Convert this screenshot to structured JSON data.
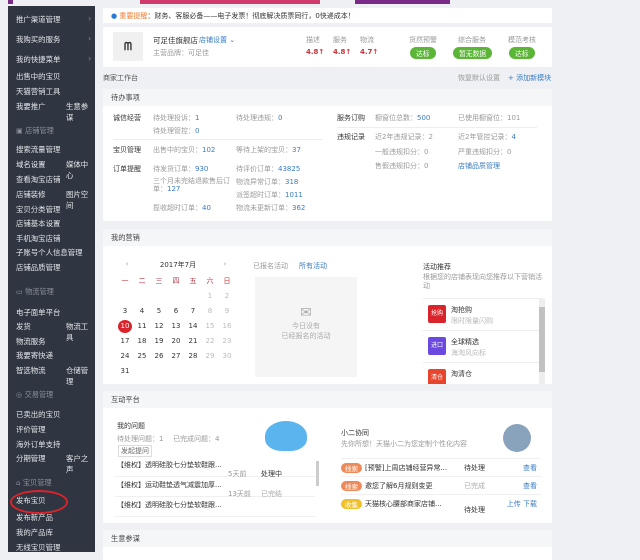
{
  "sidebar": {
    "top_items": [
      {
        "label": "推广渠道管理"
      },
      {
        "label": "我购买的服务"
      },
      {
        "label": "我的快捷菜单"
      }
    ],
    "quick": [
      "出售中的宝贝",
      "天猫营销工具",
      "我要推广",
      "生意参谋"
    ],
    "shop_header": "店铺管理",
    "shop": [
      "搜索流量管理",
      "域名设置",
      "媒体中心",
      "查看淘宝店铺",
      "店铺装修",
      "图片空间",
      "宝贝分类管理",
      "店铺基本设置",
      "手机淘宝店铺",
      "子账号个人信息管理",
      "店铺品质管理"
    ],
    "logistics_header": "物流管理",
    "logistics": [
      "电子面单平台",
      "发货",
      "物流工具",
      "物流服务",
      "我要寄快递",
      "智选物流",
      "仓储管理"
    ],
    "trade_header": "交易管理",
    "trade": [
      "已卖出的宝贝",
      "评价管理",
      "海外订单支持",
      "分期管理",
      "客户之声"
    ],
    "item_header": "宝贝管理",
    "items": [
      "发布宝贝",
      "发布新产品",
      "我的产品库",
      "无线宝贝管理"
    ]
  },
  "notice": {
    "tag": "重要提醒",
    "text": "：财务、客服必备——电子发票！彻底解决质票同行，0快递成本！"
  },
  "shop": {
    "name": "可足佳旗舰店",
    "settings": "店铺设置",
    "brand": "主营品牌：可足佳",
    "scores": [
      {
        "label": "描述",
        "value": "4.8↑"
      },
      {
        "label": "服务",
        "value": "4.8↑"
      },
      {
        "label": "物流",
        "value": "4.7↑"
      }
    ],
    "checks": [
      {
        "label": "货然预警",
        "value": "达标"
      },
      {
        "label": "综合服务",
        "value": "暂无数据"
      },
      {
        "label": "模范考核",
        "value": "达标"
      }
    ]
  },
  "workbench": {
    "title": "商家工作台",
    "restore": "恢复默认设置",
    "add": "+ 添加新模块"
  },
  "todo": {
    "title": "待办事项",
    "c1": "诚信经营",
    "c1a": "待处理投诉：",
    "c1a_v": "1",
    "c1b": "待处理违规：",
    "c1b_v": "0",
    "c1c": "待处理管控：",
    "c1c_v": "0",
    "c2": "宝贝管理",
    "c2a": "出售中的宝贝：",
    "c2a_v": "102",
    "c2b": "等待上架的宝贝：",
    "c2b_v": "37",
    "c3": "订单提醒",
    "c3a": "待发货订单：",
    "c3a_v": "930",
    "c3b": "待评价订单：",
    "c3b_v": "43825",
    "c3c": "三个月未完结退款售后订单：",
    "c3c_v": "127",
    "c3d": "物流异常订单：",
    "c3d_v": "318",
    "c3e": "派签超时订单：",
    "c3e_v": "1011",
    "c3f": "揽收超时订单：",
    "c3f_v": "40",
    "c3g": "物流未更新订单：",
    "c3g_v": "362",
    "r1": "服务订购",
    "r1a": "橱窗位总数：",
    "r1a_v": "500",
    "r1b": "已使用橱窗位：",
    "r1b_v": "101",
    "r2": "违规记录",
    "r2a": "近2年违规记录：",
    "r2a_v": "2",
    "r2b": "近2年管控记录：",
    "r2b_v": "4",
    "r2c": "一般违规扣分：",
    "r2c_v": "0",
    "r2d": "严重违规扣分：",
    "r2d_v": "0",
    "r2e": "售假违规扣分：",
    "r2e_v": "0",
    "r2f": "店铺品质管理"
  },
  "marketing": {
    "title": "我的营销",
    "month": "2017年7月",
    "prev": "‹",
    "next": "›",
    "weekdays": [
      "一",
      "二",
      "三",
      "四",
      "五",
      "六",
      "日"
    ],
    "days": [
      "1",
      "2",
      "3",
      "4",
      "5",
      "6",
      "7",
      "8",
      "9",
      "10",
      "11",
      "12",
      "13",
      "14",
      "15",
      "16",
      "17",
      "18",
      "19",
      "20",
      "21",
      "22",
      "23",
      "24",
      "25",
      "26",
      "27",
      "28",
      "29",
      "30",
      "31"
    ],
    "today": "10",
    "tab_signed": "已报名活动",
    "tab_all": "所有活动",
    "empty1": "今日没有",
    "empty2": "已经报名的活动",
    "rec_title": "活动推荐",
    "rec_desc": "根据您的店铺表现向您推荐以下营销活动",
    "recs": [
      {
        "icon": "抢购",
        "name": "淘抢购",
        "sub": "限时限量闪购",
        "color": "#d9242b"
      },
      {
        "icon": "进口",
        "name": "全球精选",
        "sub": "海淘风向标",
        "color": "#6b48e0"
      },
      {
        "icon": "清仓",
        "name": "淘清仓",
        "sub": "",
        "color": "#e8452c"
      }
    ]
  },
  "interact": {
    "title": "互动平台",
    "q_title": "我的问题",
    "pending": "待处理问题：1",
    "done": "已完成问题：4",
    "ask": "发起提问",
    "rows": [
      {
        "t": "【维权】透明硅胶七分垫软鞋跟...",
        "time": "5天前",
        "status": "处理中"
      },
      {
        "t": "【维权】运动鞋垫透气减震加厚...",
        "time": "13天前",
        "status": "已完结"
      },
      {
        "t": "【维权】透明硅胶七分垫软鞋跟...",
        "time": "",
        "status": ""
      }
    ],
    "x_title": "小二协同",
    "x_desc": "先你所想！天猫小二为您定制个性化内容",
    "x_rows": [
      {
        "tag": "线索",
        "color": "#ee8a5a",
        "t": "[预警]上周店铺经营异常...",
        "s": "待处理",
        "a": "查看"
      },
      {
        "tag": "线索",
        "color": "#ee8a5a",
        "t": "邀您了解6月规则变更",
        "s": "已完成",
        "a": "查看"
      },
      {
        "tag": "收集",
        "color": "#f0c02a",
        "t": "天猫核心腰部商家店铺...",
        "s": "待处理",
        "a": "上传  下载"
      }
    ]
  },
  "biz": {
    "title": "生意参谋"
  }
}
